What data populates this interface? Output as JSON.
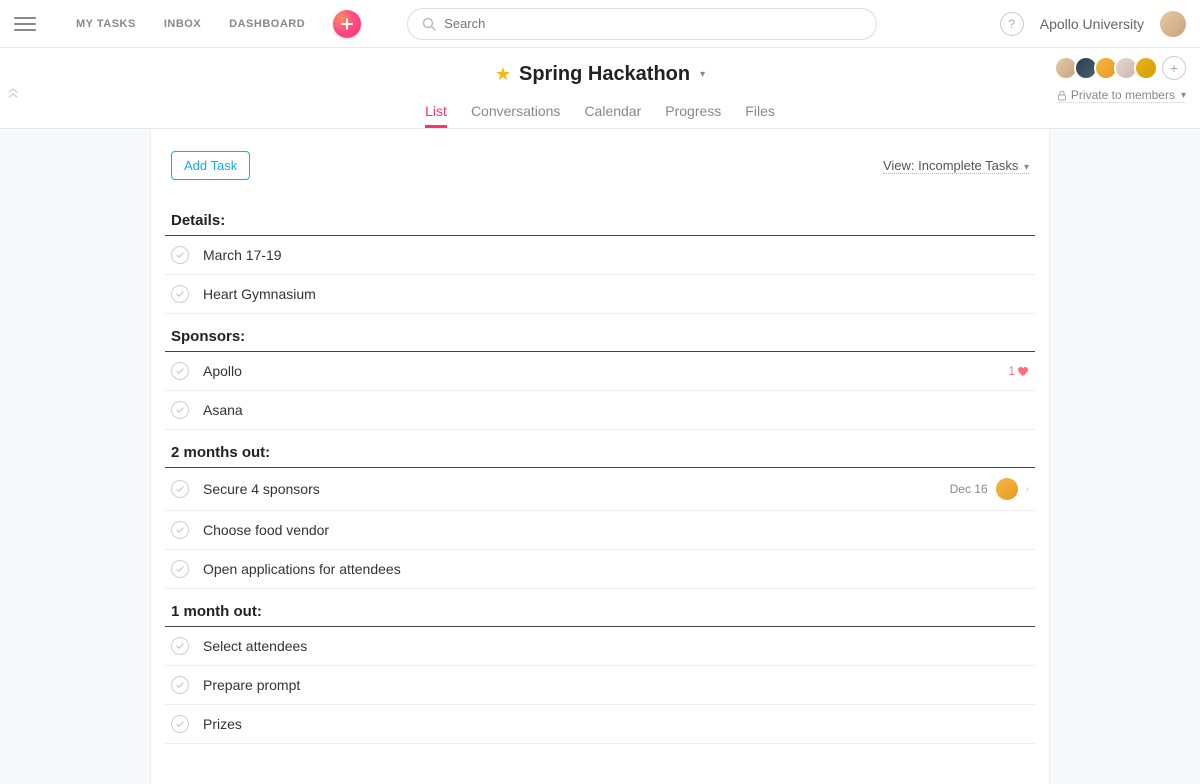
{
  "top": {
    "my_tasks": "MY TASKS",
    "inbox": "INBOX",
    "dashboard": "DASHBOARD",
    "search_placeholder": "Search",
    "workspace": "Apollo University"
  },
  "project": {
    "title": "Spring Hackathon",
    "privacy": "Private to members",
    "tabs": [
      "List",
      "Conversations",
      "Calendar",
      "Progress",
      "Files"
    ]
  },
  "toolbar": {
    "add_task": "Add Task",
    "view_label": "View: Incomplete Tasks"
  },
  "sections": [
    {
      "title": "Details:",
      "tasks": [
        {
          "title": "March 17-19"
        },
        {
          "title": "Heart Gymnasium"
        }
      ]
    },
    {
      "title": "Sponsors:",
      "tasks": [
        {
          "title": "Apollo",
          "likes": 1
        },
        {
          "title": "Asana"
        }
      ]
    },
    {
      "title": "2 months out:",
      "tasks": [
        {
          "title": "Secure 4 sponsors",
          "due": "Dec 16",
          "has_assignee": true
        },
        {
          "title": "Choose food vendor"
        },
        {
          "title": "Open applications for attendees"
        }
      ]
    },
    {
      "title": "1 month out:",
      "tasks": [
        {
          "title": "Select attendees"
        },
        {
          "title": "Prepare prompt"
        },
        {
          "title": "Prizes"
        }
      ]
    }
  ]
}
